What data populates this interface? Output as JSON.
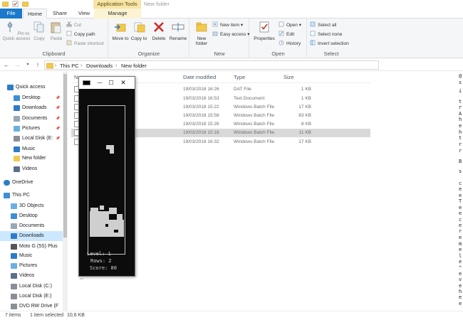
{
  "window": {
    "title": "New folder",
    "contextual_tab_group": "Application Tools"
  },
  "tabs": {
    "file": "File",
    "home": "Home",
    "share": "Share",
    "view": "View",
    "manage": "Manage"
  },
  "ribbon": {
    "clipboard": {
      "pin": "Pin to Quick access",
      "copy": "Copy",
      "paste": "Paste",
      "cut": "Cut",
      "copy_path": "Copy path",
      "paste_shortcut": "Paste shortcut",
      "label": "Clipboard"
    },
    "organize": {
      "move_to": "Move to",
      "copy_to": "Copy to",
      "delete": "Delete",
      "rename": "Rename",
      "label": "Organize"
    },
    "new": {
      "new_folder": "New folder",
      "new_item": "New item",
      "easy_access": "Easy access",
      "label": "New"
    },
    "open": {
      "properties": "Properties",
      "open": "Open",
      "edit": "Edit",
      "history": "History",
      "label": "Open"
    },
    "select": {
      "select_all": "Select all",
      "select_none": "Select none",
      "invert_selection": "Invert selection",
      "label": "Select"
    }
  },
  "address": {
    "crumbs": [
      "This PC",
      "Downloads",
      "New folder"
    ]
  },
  "nav": {
    "items": [
      {
        "label": "Quick access",
        "icon": "star-icon",
        "pinned": false
      },
      {
        "label": "Desktop",
        "icon": "desktop-icon",
        "pinned": true
      },
      {
        "label": "Downloads",
        "icon": "downloads-icon",
        "pinned": true
      },
      {
        "label": "Documents",
        "icon": "documents-icon",
        "pinned": true
      },
      {
        "label": "Pictures",
        "icon": "pictures-icon",
        "pinned": true
      },
      {
        "label": "Local Disk (E:",
        "icon": "disk-icon",
        "pinned": true
      },
      {
        "label": "Music",
        "icon": "music-icon",
        "pinned": false
      },
      {
        "label": "New folder",
        "icon": "folder-icon",
        "pinned": false
      },
      {
        "label": "Videos",
        "icon": "videos-icon",
        "pinned": false
      },
      {
        "label": "OneDrive",
        "icon": "onedrive-icon",
        "pinned": false
      },
      {
        "label": "This PC",
        "icon": "pc-icon",
        "pinned": false
      },
      {
        "label": "3D Objects",
        "icon": "objects-3d-icon",
        "pinned": false
      },
      {
        "label": "Desktop",
        "icon": "desktop-icon",
        "pinned": false
      },
      {
        "label": "Documents",
        "icon": "documents-icon",
        "pinned": false
      },
      {
        "label": "Downloads",
        "icon": "downloads-icon",
        "pinned": false
      },
      {
        "label": "Moto G (5S) Plus",
        "icon": "phone-icon",
        "pinned": false
      },
      {
        "label": "Music",
        "icon": "music-icon",
        "pinned": false
      },
      {
        "label": "Pictures",
        "icon": "pictures-icon",
        "pinned": false
      },
      {
        "label": "Videos",
        "icon": "videos-icon",
        "pinned": false
      },
      {
        "label": "Local Disk (C:)",
        "icon": "disk-icon",
        "pinned": false
      },
      {
        "label": "Local Disk (E:)",
        "icon": "disk-icon",
        "pinned": false
      },
      {
        "label": "DVD RW Drive (F",
        "icon": "dvd-icon",
        "pinned": false
      }
    ]
  },
  "files": {
    "columns": {
      "name": "Na",
      "date": "Date modified",
      "type": "Type",
      "size": "Size"
    },
    "rows": [
      {
        "date": "19/03/2018 16:26",
        "type": "DAT File",
        "size": "1 KB"
      },
      {
        "date": "19/03/2018 16:53",
        "type": "Text Document",
        "size": "1 KB"
      },
      {
        "date": "19/03/2018 15:22",
        "type": "Windows Batch File",
        "size": "17 KB"
      },
      {
        "date": "19/03/2018 15:58",
        "type": "Windows Batch File",
        "size": "83 KB"
      },
      {
        "date": "19/03/2018 15:28",
        "type": "Windows Batch File",
        "size": "8 KB"
      },
      {
        "date": "19/03/2018 15:18",
        "type": "Windows Batch File",
        "size": "11 KB"
      },
      {
        "date": "19/03/2018 16:32",
        "type": "Windows Batch File",
        "size": "17 KB"
      }
    ],
    "selected_row": 5
  },
  "right_strip": {
    "glyphs": [
      "@",
      "s",
      "i",
      "t",
      "r",
      "A",
      "h",
      "e",
      "h",
      "t",
      "r",
      "r",
      "B",
      "s",
      "c",
      "e",
      "e",
      "T",
      "e",
      "e",
      "c",
      "e",
      "r",
      "e",
      "m",
      "e",
      "l",
      "e",
      "^",
      "e",
      "v",
      "e",
      "h",
      "e",
      "e"
    ]
  },
  "status": {
    "items": "7 items",
    "selected": "1 item selected",
    "size": "10,6 KB"
  },
  "console": {
    "title_icon": "console-icon",
    "minimize": "—",
    "maximize": "☐",
    "close": "✕",
    "level": "Level: 1",
    "rows": "Rows: 2",
    "score": "Score: 80"
  }
}
